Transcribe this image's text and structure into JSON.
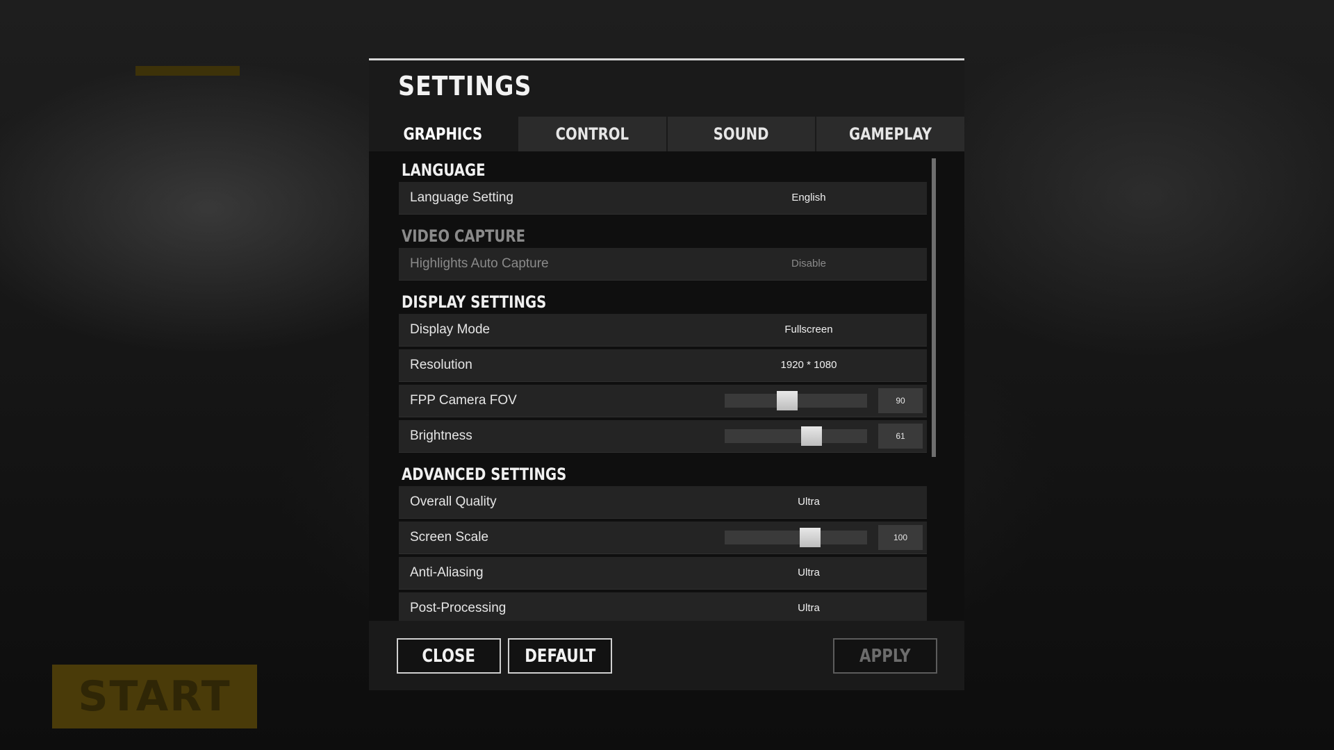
{
  "background": {
    "start_label": "START"
  },
  "modal": {
    "title": "SETTINGS"
  },
  "tabs": [
    {
      "label": "GRAPHICS",
      "active": true
    },
    {
      "label": "CONTROL",
      "active": false
    },
    {
      "label": "SOUND",
      "active": false
    },
    {
      "label": "GAMEPLAY",
      "active": false
    }
  ],
  "sections": {
    "language": {
      "header": "LANGUAGE",
      "language_setting": {
        "label": "Language Setting",
        "value": "English"
      }
    },
    "video_capture": {
      "header": "VIDEO CAPTURE",
      "highlights": {
        "label": "Highlights Auto Capture",
        "value": "Disable"
      }
    },
    "display": {
      "header": "DISPLAY SETTINGS",
      "display_mode": {
        "label": "Display Mode",
        "value": "Fullscreen"
      },
      "resolution": {
        "label": "Resolution",
        "value": "1920 * 1080"
      },
      "fov": {
        "label": "FPP Camera FOV",
        "value": "90",
        "fraction": 0.44
      },
      "brightness": {
        "label": "Brightness",
        "value": "61",
        "fraction": 0.61
      }
    },
    "advanced": {
      "header": "ADVANCED SETTINGS",
      "overall_quality": {
        "label": "Overall Quality",
        "value": "Ultra"
      },
      "screen_scale": {
        "label": "Screen Scale",
        "value": "100",
        "fraction": 0.6
      },
      "anti_aliasing": {
        "label": "Anti-Aliasing",
        "value": "Ultra"
      },
      "post_processing": {
        "label": "Post-Processing",
        "value": "Ultra"
      }
    }
  },
  "footer": {
    "close_label": "CLOSE",
    "default_label": "DEFAULT",
    "apply_label": "APPLY"
  }
}
